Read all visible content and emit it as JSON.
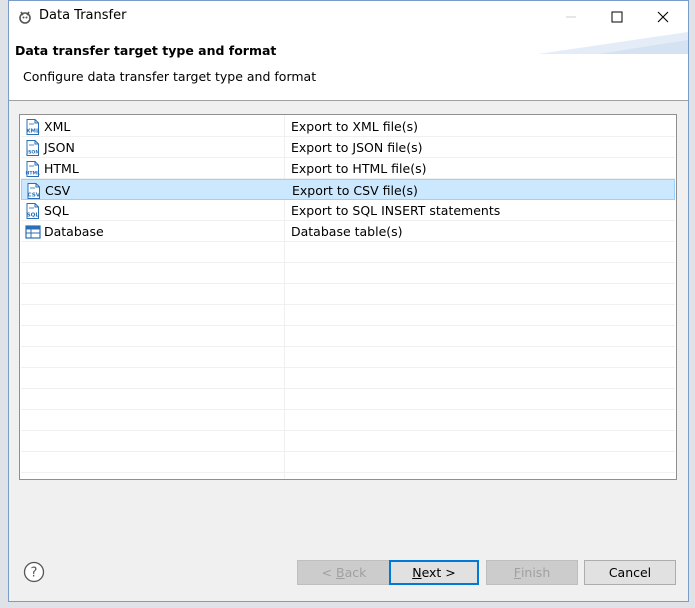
{
  "window": {
    "title": "Data Transfer"
  },
  "header": {
    "title": "Data transfer target type and format",
    "description": "Configure data transfer target type and format"
  },
  "table": {
    "rows": [
      {
        "name": "XML",
        "description": "Export to XML file(s)",
        "icon": "xml-file-icon",
        "icon_label": "XML",
        "selected": false
      },
      {
        "name": "JSON",
        "description": "Export to JSON file(s)",
        "icon": "json-file-icon",
        "icon_label": "JSON",
        "selected": false
      },
      {
        "name": "HTML",
        "description": "Export to HTML file(s)",
        "icon": "html-file-icon",
        "icon_label": "HTML",
        "selected": false
      },
      {
        "name": "CSV",
        "description": "Export to CSV file(s)",
        "icon": "csv-file-icon",
        "icon_label": "CSV",
        "selected": true
      },
      {
        "name": "SQL",
        "description": "Export to SQL INSERT statements",
        "icon": "sql-file-icon",
        "icon_label": "SQL",
        "selected": false
      },
      {
        "name": "Database",
        "description": "Database table(s)",
        "icon": "database-table-icon",
        "icon_label": "",
        "selected": false
      }
    ],
    "selection_color": "#cce8ff"
  },
  "buttons": {
    "back_prefix": "< ",
    "back_mnemonic": "B",
    "back_rest": "ack",
    "next_mnemonic": "N",
    "next_rest": "ext >",
    "finish_mnemonic": "F",
    "finish_rest": "inish",
    "cancel": "Cancel"
  },
  "colors": {
    "accent": "#0078d7",
    "icon_blue": "#2a6fb5"
  }
}
